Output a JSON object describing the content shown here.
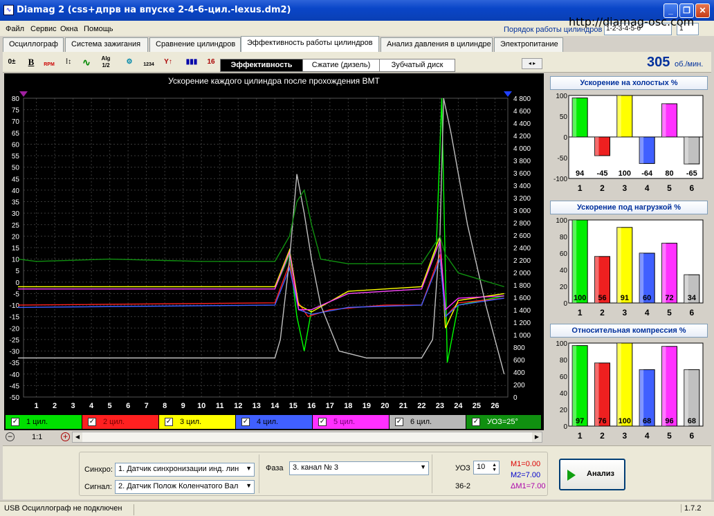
{
  "window": {
    "title": "Diamag 2 (css+дпрв на впуске 2-4-6-цил.-lexus.dm2)",
    "url": "http://diamag-osc.com"
  },
  "menu": [
    "Файл",
    "Сервис",
    "Окна",
    "Помощь"
  ],
  "firing_order": {
    "label": "Порядок работы цилиндров",
    "value": "1-2-3-4-5-6",
    "value2": "1"
  },
  "tabs": [
    "Осциллограф",
    "Система зажигания",
    "Сравнение цилиндров",
    "Эффективность работы цилиндров",
    "Анализ давления в цилиндре",
    "Электропитание"
  ],
  "active_tab": "Эффективность работы цилиндров",
  "toolbar_icons": [
    "zoom-icon",
    "bold-icon",
    "rpm-icon",
    "scale-icon",
    "smooth-icon",
    "algorithm-icon",
    "filter-icon",
    "sort-icon",
    "marker-icon",
    "engine-icon",
    "cylinder-icon"
  ],
  "toolbar_texts": {
    "alg": "Alg 1/2",
    "rpm_icon": "RPM",
    "b": "B",
    "nums": "1234",
    "sixteen": "16"
  },
  "subtabs": [
    "Эффективность",
    "Сжатие (дизель)",
    "Зубчатый диск"
  ],
  "rpm": {
    "value": "305",
    "unit": "об./мин."
  },
  "chart_data": {
    "type": "line",
    "title": "Ускорение каждого цилиндра после прохождения ВМТ",
    "x_ticks": [
      "1",
      "2",
      "3",
      "4",
      "5",
      "6",
      "7",
      "8",
      "9",
      "10",
      "11",
      "12",
      "13",
      "14",
      "15",
      "16",
      "17",
      "18",
      "19",
      "20",
      "21",
      "22",
      "23",
      "24",
      "25",
      "26"
    ],
    "y_left_range": [
      -50,
      80
    ],
    "y_left_ticks": [
      "80",
      "75",
      "70",
      "65",
      "60",
      "55",
      "50",
      "45",
      "40",
      "35",
      "30",
      "25",
      "20",
      "15",
      "10",
      "5",
      "0",
      "-5",
      "-10",
      "-15",
      "-20",
      "-25",
      "-30",
      "-35",
      "-40",
      "-45",
      "-50"
    ],
    "y_right_range": [
      0,
      4800
    ],
    "y_right_ticks": [
      "4 800",
      "4 600",
      "4 400",
      "4 200",
      "4 000",
      "3 800",
      "3 600",
      "3 400",
      "3 200",
      "3 000",
      "2 800",
      "2 600",
      "2 400",
      "2 200",
      "2 000",
      "1 800",
      "1 600",
      "1 400",
      "1 200",
      "1 000",
      "800",
      "600",
      "400",
      "200",
      "0"
    ],
    "grid": true,
    "series": [
      {
        "name": "1 цил.",
        "color": "#00ff00",
        "points": [
          [
            0,
            -3
          ],
          [
            14,
            -3
          ],
          [
            14.8,
            12
          ],
          [
            15.2,
            -15
          ],
          [
            15.6,
            -30
          ],
          [
            16,
            -12
          ],
          [
            18,
            -5
          ],
          [
            22,
            -3
          ],
          [
            22.8,
            15
          ],
          [
            23.1,
            80
          ],
          [
            23.4,
            -35
          ],
          [
            24,
            -10
          ],
          [
            26.5,
            -6
          ]
        ]
      },
      {
        "name": "2 цил.",
        "color": "#ff2020",
        "points": [
          [
            0,
            -10
          ],
          [
            14,
            -9
          ],
          [
            14.8,
            8
          ],
          [
            15.2,
            -8
          ],
          [
            15.8,
            -15
          ],
          [
            17,
            -12
          ],
          [
            20,
            -10
          ],
          [
            22,
            -10
          ],
          [
            23,
            12
          ],
          [
            23.3,
            -15
          ],
          [
            24,
            -9
          ],
          [
            26.5,
            -7
          ]
        ]
      },
      {
        "name": "3 цил.",
        "color": "#ffff00",
        "points": [
          [
            0,
            -2
          ],
          [
            14,
            -2
          ],
          [
            14.8,
            14
          ],
          [
            15.3,
            -10
          ],
          [
            16,
            -13
          ],
          [
            18,
            -4
          ],
          [
            22,
            -2
          ],
          [
            23,
            20
          ],
          [
            23.3,
            -20
          ],
          [
            24,
            -8
          ],
          [
            26.5,
            -5
          ]
        ]
      },
      {
        "name": "4 цил.",
        "color": "#4060ff",
        "points": [
          [
            0,
            -11
          ],
          [
            14,
            -10
          ],
          [
            14.8,
            6
          ],
          [
            15.3,
            -12
          ],
          [
            16,
            -14
          ],
          [
            18,
            -11
          ],
          [
            22,
            -10
          ],
          [
            23,
            10
          ],
          [
            23.3,
            -15
          ],
          [
            24,
            -10
          ],
          [
            26.5,
            -7
          ]
        ]
      },
      {
        "name": "5 цил.",
        "color": "#ff30ff",
        "points": [
          [
            0,
            -3
          ],
          [
            14,
            -3
          ],
          [
            14.8,
            13
          ],
          [
            15.3,
            -12
          ],
          [
            16,
            -12
          ],
          [
            18,
            -5
          ],
          [
            22,
            -3
          ],
          [
            23,
            18
          ],
          [
            23.3,
            -12
          ],
          [
            24,
            -7
          ],
          [
            26.5,
            -6
          ]
        ]
      },
      {
        "name": "6 цил.",
        "color": "#c0c0c0",
        "points": [
          [
            0,
            -33
          ],
          [
            14,
            -33
          ],
          [
            14.3,
            -25
          ],
          [
            14.8,
            10
          ],
          [
            15.2,
            47
          ],
          [
            15.6,
            30
          ],
          [
            16,
            10
          ],
          [
            16.5,
            -10
          ],
          [
            17.5,
            -30
          ],
          [
            19,
            -33
          ],
          [
            22,
            -33
          ],
          [
            22.6,
            -25
          ],
          [
            23,
            20
          ],
          [
            23.2,
            80
          ],
          [
            23.6,
            65
          ],
          [
            24.5,
            25
          ],
          [
            25.5,
            -10
          ],
          [
            26.5,
            -40
          ]
        ]
      },
      {
        "name": "УОЗ=25°",
        "color": "#109010",
        "points": [
          [
            0,
            10
          ],
          [
            1,
            9
          ],
          [
            5,
            10
          ],
          [
            10,
            9
          ],
          [
            14,
            9
          ],
          [
            14.8,
            20
          ],
          [
            15.2,
            35
          ],
          [
            15.6,
            40
          ],
          [
            16,
            25
          ],
          [
            16.5,
            10
          ],
          [
            18,
            8
          ],
          [
            22,
            8
          ],
          [
            23,
            20
          ],
          [
            23.3,
            12
          ],
          [
            24,
            4
          ],
          [
            26.5,
            -2
          ]
        ]
      }
    ]
  },
  "legend": [
    {
      "label": "1 цил.",
      "bg": "#00e000",
      "fg": "#000000"
    },
    {
      "label": "2 цил.",
      "bg": "#ff2020",
      "fg": "#700000"
    },
    {
      "label": "3 цил.",
      "bg": "#ffff00",
      "fg": "#000000"
    },
    {
      "label": "4 цил.",
      "bg": "#4060ff",
      "fg": "#000000"
    },
    {
      "label": "5 цил.",
      "bg": "#ff30ff",
      "fg": "#700070"
    },
    {
      "label": "6 цил.",
      "bg": "#b8b8b8",
      "fg": "#000000"
    },
    {
      "label": "УОЗ=25°",
      "bg": "#109010",
      "fg": "#ffffff"
    }
  ],
  "zoom_label": "1:1",
  "bar_panels": [
    {
      "title": "Ускорение на холостых %",
      "ylim": [
        -100,
        100
      ],
      "ticks": [
        "100",
        "50",
        "0",
        "-50",
        "-100"
      ],
      "values": [
        94,
        -45,
        100,
        -64,
        80,
        -65
      ]
    },
    {
      "title": "Ускорение под нагрузкой %",
      "ylim": [
        0,
        100
      ],
      "ticks": [
        "100",
        "80",
        "60",
        "40",
        "20",
        "0"
      ],
      "values": [
        100,
        56,
        91,
        60,
        72,
        34
      ]
    },
    {
      "title": "Относительная компрессия %",
      "ylim": [
        0,
        100
      ],
      "ticks": [
        "100",
        "80",
        "60",
        "40",
        "20",
        "0"
      ],
      "values": [
        97,
        76,
        100,
        68,
        96,
        68
      ]
    }
  ],
  "bar_colors": [
    "#00ee00",
    "#ee2020",
    "#ffff00",
    "#4060ff",
    "#ff30ff",
    "#c0c0c0"
  ],
  "bar_categories": [
    "1",
    "2",
    "3",
    "4",
    "5",
    "6"
  ],
  "bottom": {
    "sync_label": "Синхро:",
    "sync_value": "1.  Датчик синхронизации инд. лин",
    "signal_label": "Сигнал:",
    "signal_value": "2.  Датчик Полож Коленчатого Вал",
    "phase_label": "Фаза",
    "phase_value": "3.  канал № 3",
    "uoz_label": "УОЗ",
    "uoz_value": "10",
    "teeth": "36-2",
    "m1": "M1=0.00",
    "m2": "M2=7.00",
    "dm1": "ΔM1=7.00",
    "analyze_label": "Анализ"
  },
  "status": {
    "text": "USB Осциллограф не подключен",
    "version": "1.7.2"
  }
}
